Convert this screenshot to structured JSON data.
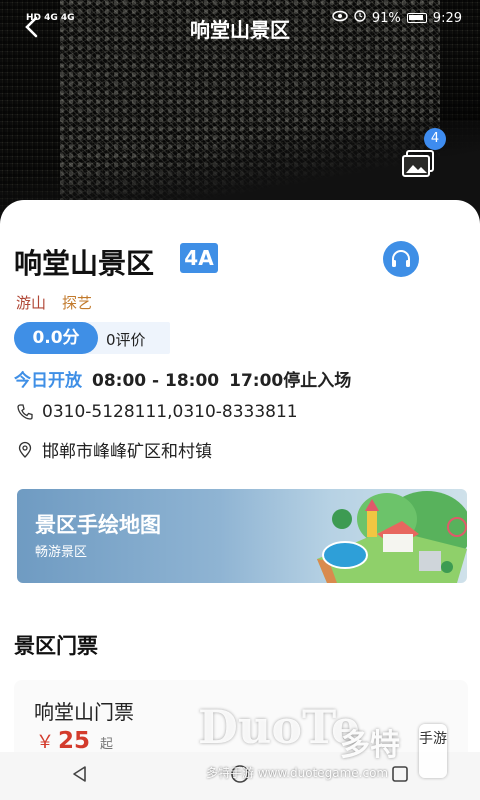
{
  "status_bar": {
    "network_left": "HD 4G 4G",
    "battery": "91%",
    "time": "9:29"
  },
  "header": {
    "title": "响堂山景区",
    "gallery_count": "4"
  },
  "scenic": {
    "name": "响堂山景区",
    "grade": "4A",
    "tags": [
      "游山",
      "探艺"
    ],
    "score": "0.0分",
    "reviews": "0评价",
    "open_label": "今日开放",
    "open_time": "08:00 - 18:00",
    "stop_entry": "17:00停止入场",
    "phone": "0310-5128111,0310-8333811",
    "address": "邯郸市峰峰矿区和村镇"
  },
  "map_card": {
    "title": "景区手绘地图",
    "subtitle": "畅游景区"
  },
  "tickets": {
    "section_title": "景区门票",
    "items": [
      {
        "name": "响堂山门票",
        "currency": "￥",
        "price": "25",
        "suffix": "起"
      }
    ]
  },
  "watermark": {
    "logo": "DuoTe",
    "cn": "多特",
    "box": "手游",
    "url": "多特手游 www.duotegame.com"
  },
  "colors": {
    "accent": "#3f8fe6",
    "price": "#d33b2c",
    "tag1": "#b04736",
    "tag2": "#c27a2c"
  }
}
